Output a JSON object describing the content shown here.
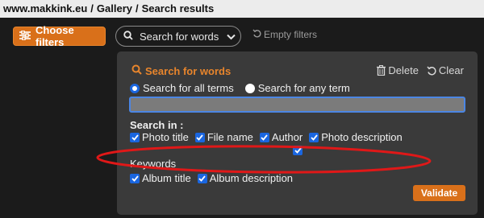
{
  "breadcrumb": {
    "items": [
      "www.makkink.eu",
      "Gallery",
      "Search results"
    ],
    "separator": "/"
  },
  "toolbar": {
    "choose_filters_label": "Choose filters",
    "search_dropdown_label": "Search for words",
    "empty_filters_label": "Empty filters"
  },
  "panel": {
    "title": "Search for words",
    "delete_label": "Delete",
    "clear_label": "Clear",
    "radio_all_label": "Search for all terms",
    "radio_any_label": "Search for any term",
    "radio_selected": "all",
    "search_value": "",
    "search_in_label": "Search in :",
    "options_row1": [
      {
        "label": "Photo title",
        "checked": true
      },
      {
        "label": "File name",
        "checked": true
      },
      {
        "label": "Author",
        "checked": true
      },
      {
        "label": "Photo description",
        "checked": true
      }
    ],
    "keywords": {
      "label": "Keywords",
      "checked": true
    },
    "options_row3": [
      {
        "label": "Album title",
        "checked": true
      },
      {
        "label": "Album description",
        "checked": true
      }
    ],
    "validate_label": "Validate"
  },
  "colors": {
    "accent": "#d9701a",
    "checkbox": "#1a66e0",
    "annotation": "#e01818"
  }
}
